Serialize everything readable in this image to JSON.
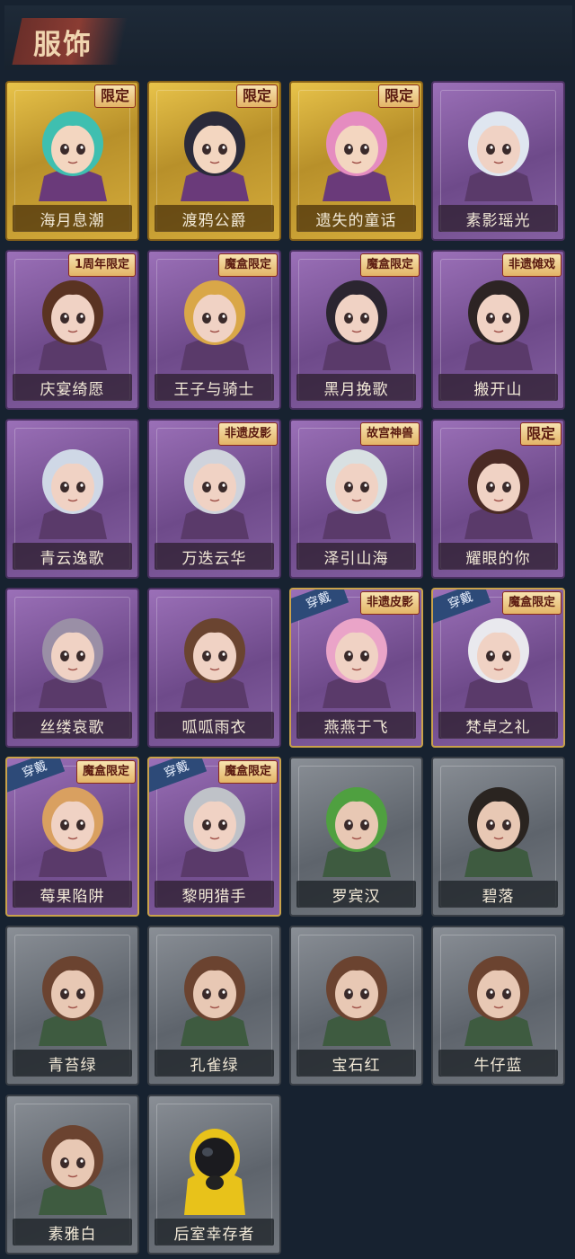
{
  "header": {
    "title": "服饰"
  },
  "colors": {
    "background": "#172230",
    "gold": "#d6ad3c",
    "purple": "#7e58a0",
    "grey": "#6a7078",
    "tag": "#e3b466",
    "worn_badge": "#2d4a78"
  },
  "worn_label": "穿戴",
  "costumes": [
    {
      "name": "海月息潮",
      "rarity": "gold",
      "tag": "限定",
      "worn": false,
      "portrait": "teal-hair-crown-icon"
    },
    {
      "name": "渡鸦公爵",
      "rarity": "gold",
      "tag": "限定",
      "worn": false,
      "portrait": "dark-hair-noble-icon"
    },
    {
      "name": "遗失的童话",
      "rarity": "gold",
      "tag": "限定",
      "worn": false,
      "portrait": "pink-hair-girl-icon"
    },
    {
      "name": "素影瑶光",
      "rarity": "purple",
      "tag": "",
      "worn": false,
      "portrait": "white-hair-girl-icon"
    },
    {
      "name": "庆宴绮愿",
      "rarity": "purple",
      "tag": "1周年限定",
      "worn": false,
      "portrait": "cake-boy-icon"
    },
    {
      "name": "王子与骑士",
      "rarity": "purple",
      "tag": "魔盒限定",
      "worn": false,
      "portrait": "blonde-prince-icon"
    },
    {
      "name": "黑月挽歌",
      "rarity": "purple",
      "tag": "魔盒限定",
      "worn": false,
      "portrait": "dark-curls-girl-icon"
    },
    {
      "name": "搬开山",
      "rarity": "purple",
      "tag": "非遗傩戏",
      "worn": false,
      "portrait": "masked-boy-icon"
    },
    {
      "name": "青云逸歌",
      "rarity": "purple",
      "tag": "",
      "worn": false,
      "portrait": "silver-hair-boy-icon"
    },
    {
      "name": "万迭云华",
      "rarity": "purple",
      "tag": "非遗皮影",
      "worn": false,
      "portrait": "long-silver-hair-icon"
    },
    {
      "name": "泽引山海",
      "rarity": "purple",
      "tag": "故宫神兽",
      "worn": false,
      "portrait": "horned-boy-icon"
    },
    {
      "name": "耀眼的你",
      "rarity": "purple",
      "tag": "限定",
      "worn": false,
      "portrait": "cowboy-hat-girl-icon"
    },
    {
      "name": "丝缕哀歌",
      "rarity": "purple",
      "tag": "",
      "worn": false,
      "portrait": "lace-headband-girl-icon"
    },
    {
      "name": "呱呱雨衣",
      "rarity": "purple",
      "tag": "",
      "worn": false,
      "portrait": "frog-hat-girl-icon"
    },
    {
      "name": "燕燕于飞",
      "rarity": "purple",
      "tag": "非遗皮影",
      "worn": true,
      "portrait": "pink-curls-girl-icon"
    },
    {
      "name": "梵卓之礼",
      "rarity": "purple",
      "tag": "魔盒限定",
      "worn": true,
      "portrait": "vampire-girl-icon"
    },
    {
      "name": "莓果陷阱",
      "rarity": "purple",
      "tag": "魔盒限定",
      "worn": true,
      "portrait": "berry-hat-girl-icon"
    },
    {
      "name": "黎明猎手",
      "rarity": "purple",
      "tag": "魔盒限定",
      "worn": true,
      "portrait": "hunter-boy-icon"
    },
    {
      "name": "罗宾汉",
      "rarity": "grey",
      "tag": "",
      "worn": false,
      "portrait": "green-hood-icon"
    },
    {
      "name": "碧落",
      "rarity": "grey",
      "tag": "",
      "worn": false,
      "portrait": "dark-hair-boy-icon"
    },
    {
      "name": "青苔绿",
      "rarity": "grey",
      "tag": "",
      "worn": false,
      "portrait": "brown-hair-girl-icon"
    },
    {
      "name": "孔雀绿",
      "rarity": "grey",
      "tag": "",
      "worn": false,
      "portrait": "brown-hair-girl-icon"
    },
    {
      "name": "宝石红",
      "rarity": "grey",
      "tag": "",
      "worn": false,
      "portrait": "brown-hair-girl-icon"
    },
    {
      "name": "牛仔蓝",
      "rarity": "grey",
      "tag": "",
      "worn": false,
      "portrait": "brown-hair-girl-icon"
    },
    {
      "name": "素雅白",
      "rarity": "grey",
      "tag": "",
      "worn": false,
      "portrait": "brown-hair-girl-icon"
    },
    {
      "name": "后室幸存者",
      "rarity": "grey",
      "tag": "",
      "worn": false,
      "portrait": "gas-mask-icon"
    }
  ]
}
